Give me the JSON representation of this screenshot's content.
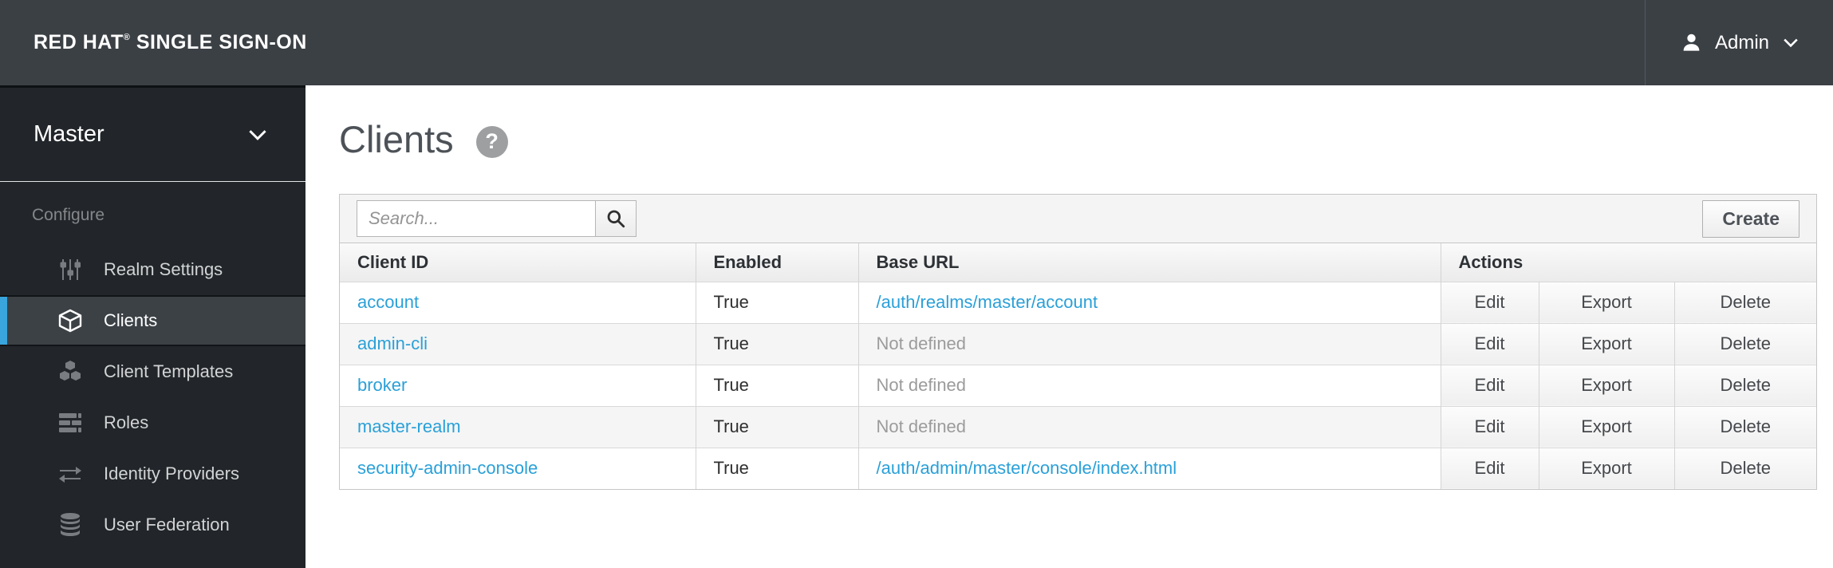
{
  "topbar": {
    "brand": "RED HAT",
    "brand_mark": "®",
    "brand_rest": " SINGLE SIGN-ON",
    "user": {
      "label": "Admin"
    }
  },
  "sidebar": {
    "realm": "Master",
    "section": "Configure",
    "items": [
      {
        "label": "Realm Settings",
        "icon": "sliders-icon",
        "selected": false
      },
      {
        "label": "Clients",
        "icon": "cube-icon",
        "selected": true
      },
      {
        "label": "Client Templates",
        "icon": "cubes-icon",
        "selected": false
      },
      {
        "label": "Roles",
        "icon": "list-icon",
        "selected": false
      },
      {
        "label": "Identity Providers",
        "icon": "exchange-arrows-icon",
        "selected": false
      },
      {
        "label": "User Federation",
        "icon": "database-icon",
        "selected": false
      }
    ]
  },
  "main": {
    "title": "Clients",
    "help_glyph": "?",
    "toolbar": {
      "search_placeholder": "Search...",
      "create_label": "Create"
    },
    "table": {
      "headers": [
        "Client ID",
        "Enabled",
        "Base URL",
        "Actions"
      ],
      "actions": [
        "Edit",
        "Export",
        "Delete"
      ],
      "rows": [
        {
          "client_id": "account",
          "enabled": "True",
          "base_url": "/auth/realms/master/account",
          "base_url_defined": true
        },
        {
          "client_id": "admin-cli",
          "enabled": "True",
          "base_url": "Not defined",
          "base_url_defined": false
        },
        {
          "client_id": "broker",
          "enabled": "True",
          "base_url": "Not defined",
          "base_url_defined": false
        },
        {
          "client_id": "master-realm",
          "enabled": "True",
          "base_url": "Not defined",
          "base_url_defined": false
        },
        {
          "client_id": "security-admin-console",
          "enabled": "True",
          "base_url": "/auth/admin/master/console/index.html",
          "base_url_defined": true
        }
      ]
    }
  },
  "colors": {
    "topbar_bg": "#3b4045",
    "sidebar_bg": "#22262a",
    "selected_item_bg": "#3c4146",
    "accent_blue": "#39a5dc",
    "link_blue": "#2aa0d8",
    "muted_text": "#9b9b9b"
  }
}
